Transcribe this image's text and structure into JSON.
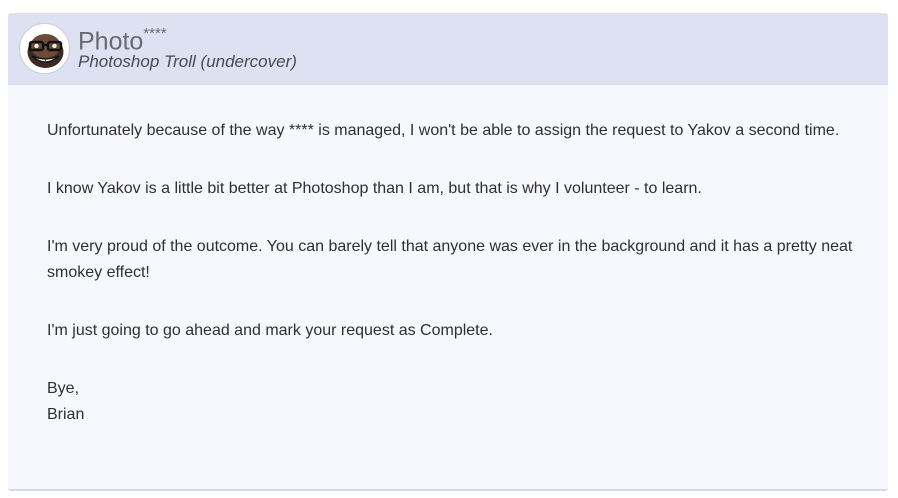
{
  "post": {
    "author": {
      "name": "Photo",
      "name_suffix": "****",
      "role": "Photoshop Troll (undercover)",
      "avatar_icon": "troll-face-avatar-icon"
    },
    "paragraphs": [
      "Unfortunately because of the way **** is managed, I won't be able to assign the request to Yakov a second time.",
      "I know Yakov is a little bit better at Photoshop than I am, but that is why I volunteer - to learn.",
      "I'm very proud of the outcome. You can barely tell that anyone was ever in the background and it has a pretty neat smokey effect!",
      "I'm just going to go ahead and mark your request as Complete."
    ],
    "signoff": {
      "greeting": "Bye,",
      "signature": "Brian"
    }
  },
  "colors": {
    "header_bg": "#dde1f1",
    "body_bg": "#f7f8fd",
    "text": "#2f2f33"
  }
}
